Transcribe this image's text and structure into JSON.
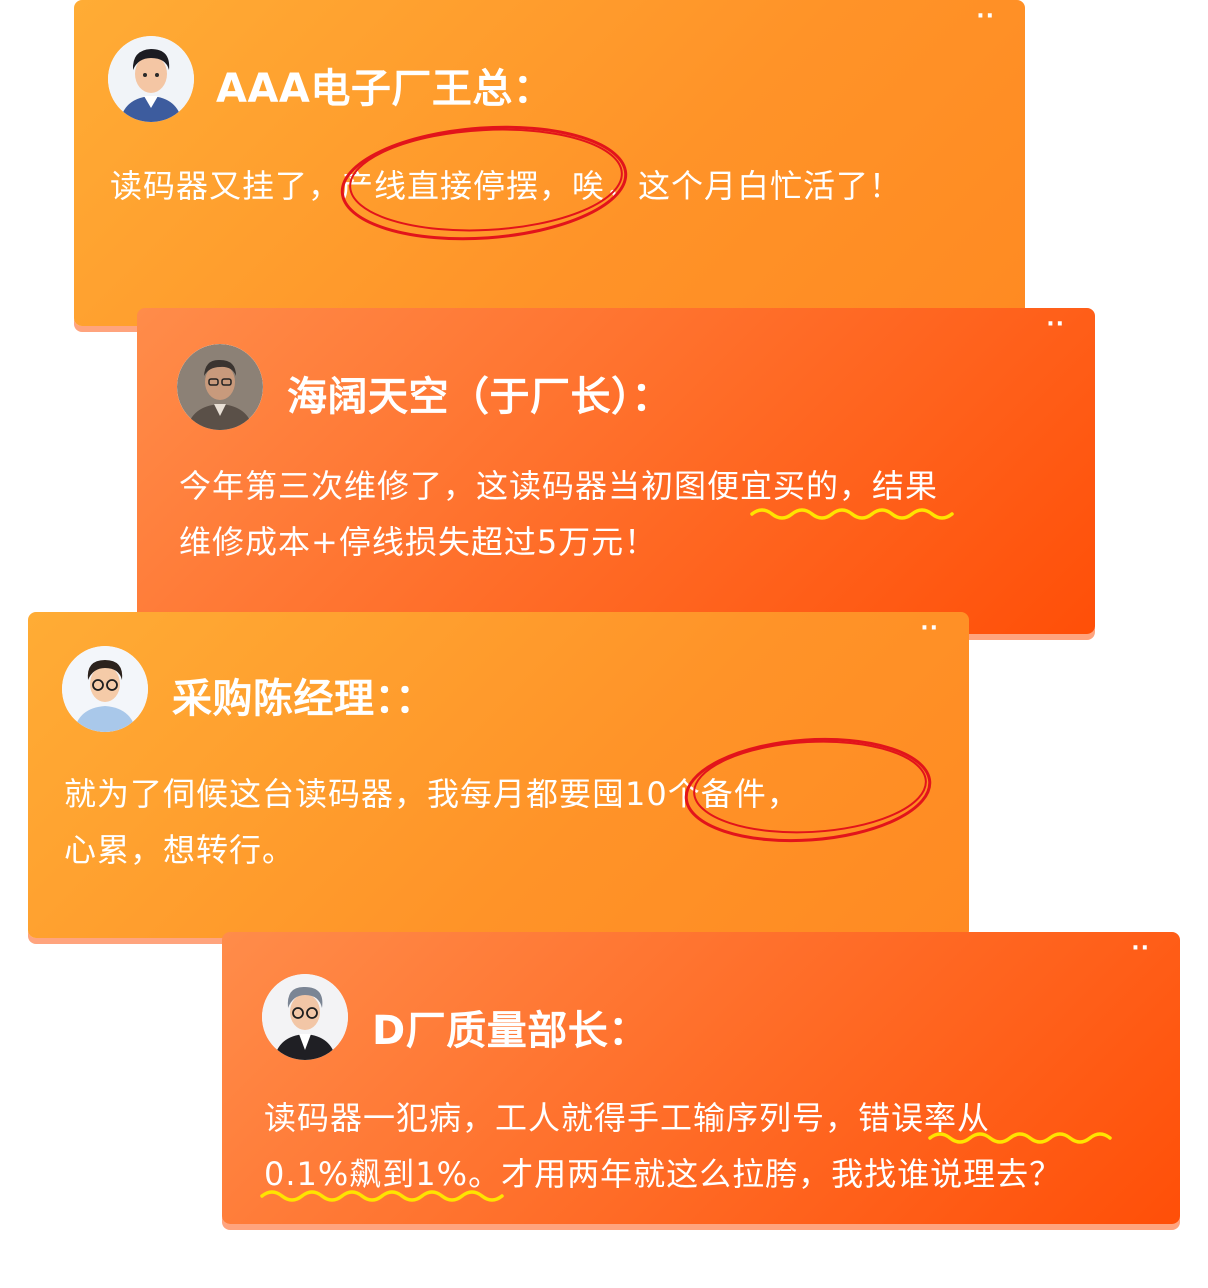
{
  "cards": [
    {
      "name": "AAA电子厂王总：",
      "lines": [
        [
          "读码器又挂了，",
          "产线直接停摆",
          "，唉，这个月白忙活了！"
        ]
      ]
    },
    {
      "name": "海阔天空（于厂长）：",
      "lines": [
        [
          "今年第三次维修了，这读码器当初",
          "图便宜买的",
          "，结果"
        ],
        [
          "维修成本+停线损失超过5万元！"
        ]
      ]
    },
    {
      "name": "采购陈经理：：",
      "lines": [
        [
          "就为了伺候这台读码器，我每月都要",
          "囤10个备件",
          "，"
        ],
        [
          "心累，想转行。"
        ]
      ]
    },
    {
      "name": "D厂质量部长：",
      "lines": [
        [
          "读码器一犯病，工人就得手工输序列号，",
          "错误率从"
        ],
        [
          "0.1%飙到1%",
          "。才用两年就这么拉胯，我找谁说理去？"
        ]
      ]
    }
  ],
  "dots_icon": "more-dots-icon",
  "colors": {
    "card_orange": "#ff9a2e",
    "card_red": "#ff5a12",
    "circle_mark": "#e2141b",
    "wavy_underline": "#ffe400"
  }
}
